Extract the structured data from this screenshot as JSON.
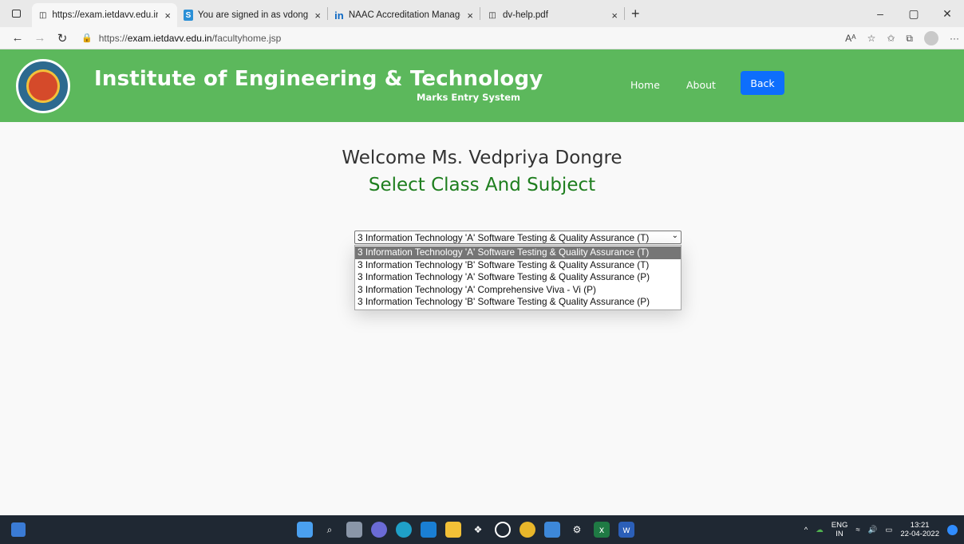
{
  "browser": {
    "tabs": [
      {
        "title": "https://exam.ietdavv.edu.in/facul",
        "icon": "page-icon",
        "active": true
      },
      {
        "title": "You are signed in as vdongre.iet",
        "icon": "s-icon",
        "active": false
      },
      {
        "title": "NAAC Accreditation Managemer",
        "icon": "linkedin-icon",
        "active": false
      },
      {
        "title": "dv-help.pdf",
        "icon": "page-icon",
        "active": false
      }
    ],
    "url": {
      "prefix": "https://",
      "host": "exam.ietdavv.edu.in",
      "path": "/facultyhome.jsp"
    }
  },
  "header": {
    "brand": "Institute of Engineering & Technology",
    "subtitle": "Marks Entry System",
    "nav": {
      "home": "Home",
      "about": "About",
      "back": "Back"
    },
    "color": "#5cb85c"
  },
  "main": {
    "welcome": "Welcome Ms. Vedpriya Dongre",
    "heading": "Select Class And Subject",
    "select": {
      "selected": "3 Information Technology 'A' Software Testing & Quality Assurance (T)",
      "options": [
        "3 Information Technology 'A' Software Testing & Quality Assurance (T)",
        "3 Information Technology 'B' Software Testing & Quality Assurance (T)",
        "3 Information Technology 'A' Software Testing & Quality Assurance (P)",
        "3 Information Technology 'A' Comprehensive Viva - Vi (P)",
        "3 Information Technology 'B' Software Testing & Quality Assurance (P)"
      ]
    }
  },
  "taskbar": {
    "lang": "ENG",
    "region": "IN",
    "time": "13:21",
    "date": "22-04-2022"
  }
}
